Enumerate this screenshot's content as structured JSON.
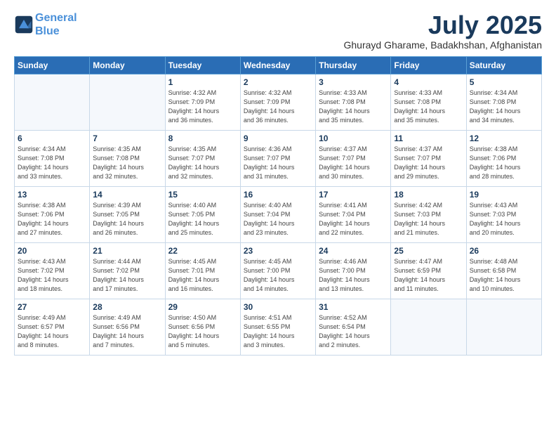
{
  "header": {
    "logo_line1": "General",
    "logo_line2": "Blue",
    "month": "July 2025",
    "location": "Ghurayd Gharame, Badakhshan, Afghanistan"
  },
  "weekdays": [
    "Sunday",
    "Monday",
    "Tuesday",
    "Wednesday",
    "Thursday",
    "Friday",
    "Saturday"
  ],
  "weeks": [
    [
      {
        "day": "",
        "info": ""
      },
      {
        "day": "",
        "info": ""
      },
      {
        "day": "1",
        "info": "Sunrise: 4:32 AM\nSunset: 7:09 PM\nDaylight: 14 hours\nand 36 minutes."
      },
      {
        "day": "2",
        "info": "Sunrise: 4:32 AM\nSunset: 7:09 PM\nDaylight: 14 hours\nand 36 minutes."
      },
      {
        "day": "3",
        "info": "Sunrise: 4:33 AM\nSunset: 7:08 PM\nDaylight: 14 hours\nand 35 minutes."
      },
      {
        "day": "4",
        "info": "Sunrise: 4:33 AM\nSunset: 7:08 PM\nDaylight: 14 hours\nand 35 minutes."
      },
      {
        "day": "5",
        "info": "Sunrise: 4:34 AM\nSunset: 7:08 PM\nDaylight: 14 hours\nand 34 minutes."
      }
    ],
    [
      {
        "day": "6",
        "info": "Sunrise: 4:34 AM\nSunset: 7:08 PM\nDaylight: 14 hours\nand 33 minutes."
      },
      {
        "day": "7",
        "info": "Sunrise: 4:35 AM\nSunset: 7:08 PM\nDaylight: 14 hours\nand 32 minutes."
      },
      {
        "day": "8",
        "info": "Sunrise: 4:35 AM\nSunset: 7:07 PM\nDaylight: 14 hours\nand 32 minutes."
      },
      {
        "day": "9",
        "info": "Sunrise: 4:36 AM\nSunset: 7:07 PM\nDaylight: 14 hours\nand 31 minutes."
      },
      {
        "day": "10",
        "info": "Sunrise: 4:37 AM\nSunset: 7:07 PM\nDaylight: 14 hours\nand 30 minutes."
      },
      {
        "day": "11",
        "info": "Sunrise: 4:37 AM\nSunset: 7:07 PM\nDaylight: 14 hours\nand 29 minutes."
      },
      {
        "day": "12",
        "info": "Sunrise: 4:38 AM\nSunset: 7:06 PM\nDaylight: 14 hours\nand 28 minutes."
      }
    ],
    [
      {
        "day": "13",
        "info": "Sunrise: 4:38 AM\nSunset: 7:06 PM\nDaylight: 14 hours\nand 27 minutes."
      },
      {
        "day": "14",
        "info": "Sunrise: 4:39 AM\nSunset: 7:05 PM\nDaylight: 14 hours\nand 26 minutes."
      },
      {
        "day": "15",
        "info": "Sunrise: 4:40 AM\nSunset: 7:05 PM\nDaylight: 14 hours\nand 25 minutes."
      },
      {
        "day": "16",
        "info": "Sunrise: 4:40 AM\nSunset: 7:04 PM\nDaylight: 14 hours\nand 23 minutes."
      },
      {
        "day": "17",
        "info": "Sunrise: 4:41 AM\nSunset: 7:04 PM\nDaylight: 14 hours\nand 22 minutes."
      },
      {
        "day": "18",
        "info": "Sunrise: 4:42 AM\nSunset: 7:03 PM\nDaylight: 14 hours\nand 21 minutes."
      },
      {
        "day": "19",
        "info": "Sunrise: 4:43 AM\nSunset: 7:03 PM\nDaylight: 14 hours\nand 20 minutes."
      }
    ],
    [
      {
        "day": "20",
        "info": "Sunrise: 4:43 AM\nSunset: 7:02 PM\nDaylight: 14 hours\nand 18 minutes."
      },
      {
        "day": "21",
        "info": "Sunrise: 4:44 AM\nSunset: 7:02 PM\nDaylight: 14 hours\nand 17 minutes."
      },
      {
        "day": "22",
        "info": "Sunrise: 4:45 AM\nSunset: 7:01 PM\nDaylight: 14 hours\nand 16 minutes."
      },
      {
        "day": "23",
        "info": "Sunrise: 4:45 AM\nSunset: 7:00 PM\nDaylight: 14 hours\nand 14 minutes."
      },
      {
        "day": "24",
        "info": "Sunrise: 4:46 AM\nSunset: 7:00 PM\nDaylight: 14 hours\nand 13 minutes."
      },
      {
        "day": "25",
        "info": "Sunrise: 4:47 AM\nSunset: 6:59 PM\nDaylight: 14 hours\nand 11 minutes."
      },
      {
        "day": "26",
        "info": "Sunrise: 4:48 AM\nSunset: 6:58 PM\nDaylight: 14 hours\nand 10 minutes."
      }
    ],
    [
      {
        "day": "27",
        "info": "Sunrise: 4:49 AM\nSunset: 6:57 PM\nDaylight: 14 hours\nand 8 minutes."
      },
      {
        "day": "28",
        "info": "Sunrise: 4:49 AM\nSunset: 6:56 PM\nDaylight: 14 hours\nand 7 minutes."
      },
      {
        "day": "29",
        "info": "Sunrise: 4:50 AM\nSunset: 6:56 PM\nDaylight: 14 hours\nand 5 minutes."
      },
      {
        "day": "30",
        "info": "Sunrise: 4:51 AM\nSunset: 6:55 PM\nDaylight: 14 hours\nand 3 minutes."
      },
      {
        "day": "31",
        "info": "Sunrise: 4:52 AM\nSunset: 6:54 PM\nDaylight: 14 hours\nand 2 minutes."
      },
      {
        "day": "",
        "info": ""
      },
      {
        "day": "",
        "info": ""
      }
    ]
  ]
}
